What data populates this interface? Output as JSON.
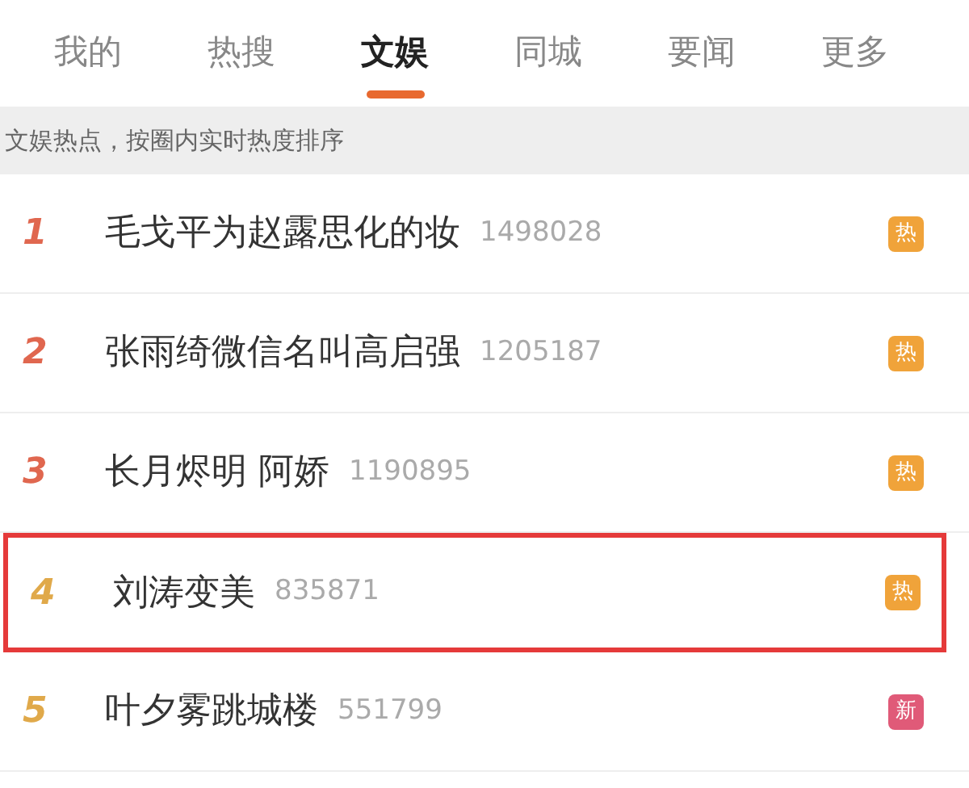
{
  "tabs": [
    {
      "label": "我的",
      "selected": false
    },
    {
      "label": "热搜",
      "selected": false
    },
    {
      "label": "文娱",
      "selected": true
    },
    {
      "label": "同城",
      "selected": false
    },
    {
      "label": "要闻",
      "selected": false
    },
    {
      "label": "更多",
      "selected": false
    }
  ],
  "notice": "文娱热点，按圈内实时热度排序",
  "items": [
    {
      "rank": "1",
      "color": "#e0674f",
      "title": "毛戈平为赵露思化的妆",
      "count": "1498028",
      "badge": {
        "kind": "hot",
        "label": "热"
      },
      "highlighted": false
    },
    {
      "rank": "2",
      "color": "#e0674f",
      "title": "张雨绮微信名叫高启强",
      "count": "1205187",
      "badge": {
        "kind": "hot",
        "label": "热"
      },
      "highlighted": false
    },
    {
      "rank": "3",
      "color": "#e0674f",
      "title": "长月烬明 阿娇",
      "count": "1190895",
      "badge": {
        "kind": "hot",
        "label": "热"
      },
      "highlighted": false
    },
    {
      "rank": "4",
      "color": "#e0a94a",
      "title": "刘涛变美",
      "count": "835871",
      "badge": {
        "kind": "hot",
        "label": "热"
      },
      "highlighted": true
    },
    {
      "rank": "5",
      "color": "#e0a94a",
      "title": "叶夕雾跳城楼",
      "count": "551799",
      "badge": {
        "kind": "new",
        "label": "新"
      },
      "highlighted": false
    }
  ]
}
